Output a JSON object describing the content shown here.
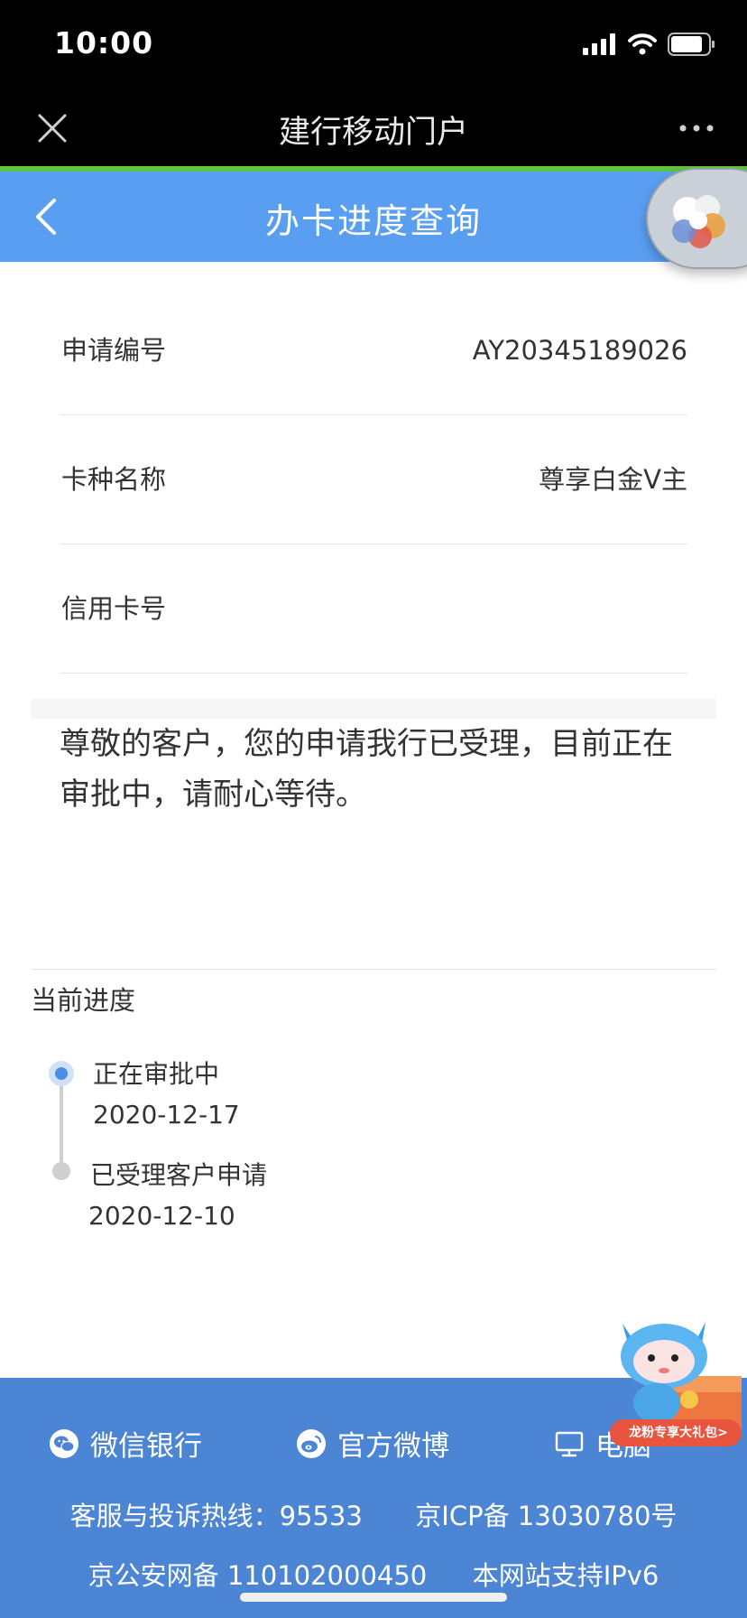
{
  "status_bar": {
    "time": "10:00"
  },
  "wechat_nav": {
    "title": "建行移动门户"
  },
  "page": {
    "title": "办卡进度查询"
  },
  "info": [
    {
      "label": "申请编号",
      "value": "AY20345189026"
    },
    {
      "label": "卡种名称",
      "value": "尊享白金V主"
    },
    {
      "label": "信用卡号",
      "value": ""
    }
  ],
  "notice": "尊敬的客户，您的申请我行已受理，目前正在审批中，请耐心等待。",
  "progress": {
    "title": "当前进度",
    "steps": [
      {
        "status": "正在审批中",
        "date": "2020-12-17",
        "active": true
      },
      {
        "status": "已受理客户申请",
        "date": "2020-12-10",
        "active": false
      }
    ]
  },
  "footer": {
    "links": [
      {
        "label": "微信银行",
        "icon": "wechat-icon"
      },
      {
        "label": "官方微博",
        "icon": "weibo-icon"
      },
      {
        "label": "电脑",
        "icon": "computer-icon"
      }
    ],
    "hotline": "客服与投诉热线：95533",
    "icp": "京ICP备 13030780号",
    "police": "京公安网备 110102000450",
    "ipv6": "本网站支持IPv6"
  },
  "promo": {
    "badge": "龙粉专享大礼包>"
  },
  "colors": {
    "header": "#5a9ef2",
    "footer": "#4b85d3",
    "progress_active": "#4a8ee8",
    "wechat_loading": "#5fc43f"
  }
}
